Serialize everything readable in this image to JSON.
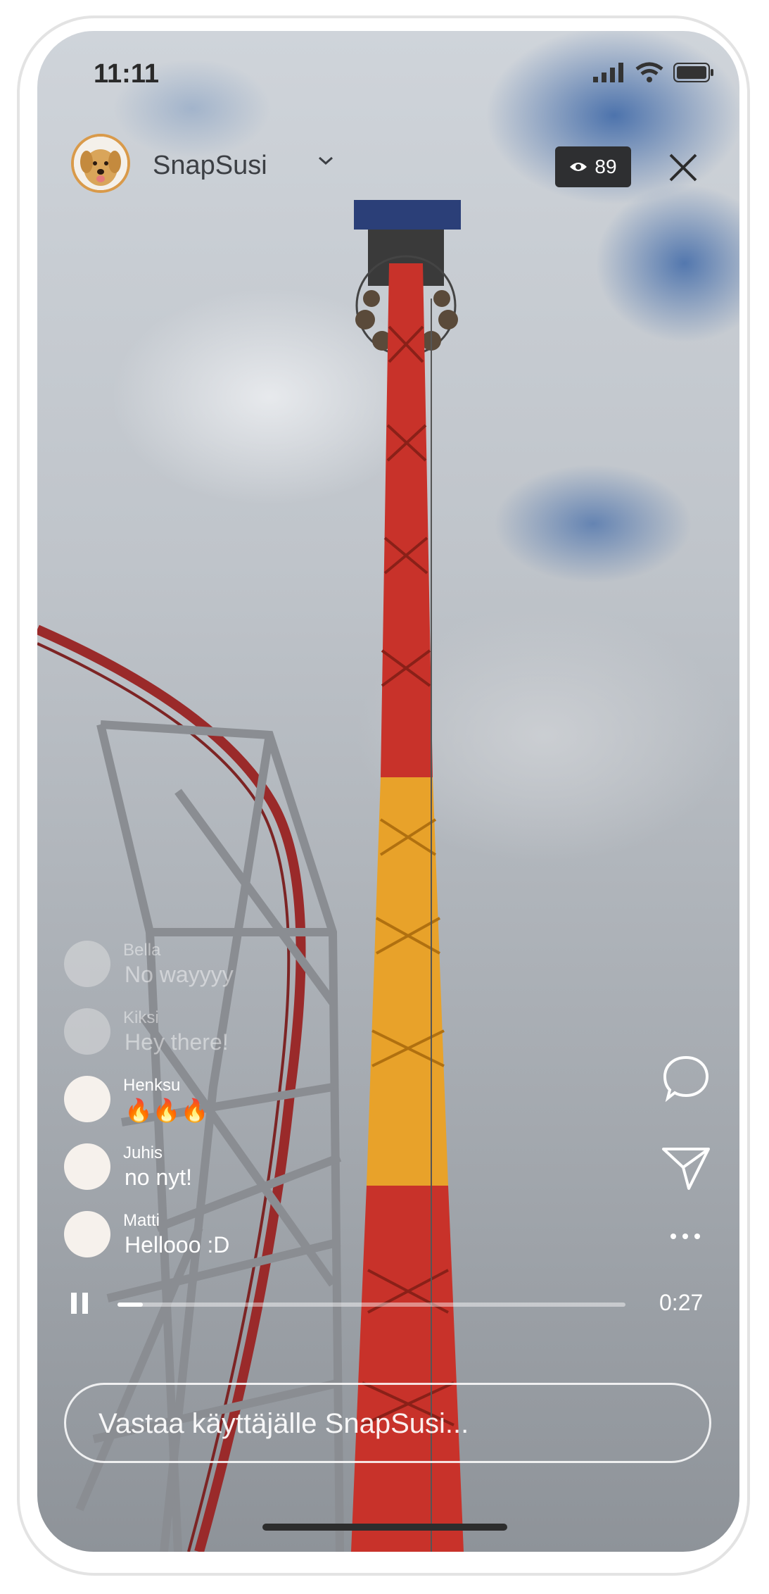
{
  "status_bar": {
    "time": "11:11"
  },
  "header": {
    "username": "SnapSusi",
    "viewer_count": "89"
  },
  "comments": [
    {
      "name": "Bella",
      "text": "No wayyyy",
      "faded": true
    },
    {
      "name": "Kiksi",
      "text": "Hey there!",
      "faded": true
    },
    {
      "name": "Henksu",
      "text": "🔥🔥🔥",
      "faded": false
    },
    {
      "name": "Juhis",
      "text": "no nyt!",
      "faded": false
    },
    {
      "name": "Matti",
      "text": "Hellooo :D",
      "faded": false
    }
  ],
  "playback": {
    "progress": 0.05,
    "duration": "0:27"
  },
  "reply": {
    "placeholder": "Vastaa käyttäjälle SnapSusi..."
  },
  "colors": {
    "tower_red": "#c8322a",
    "tower_orange": "#e8a22a",
    "coaster_gray": "#8a8d92"
  },
  "icons": [
    "signal-icon",
    "wifi-icon",
    "battery-icon",
    "chevron-down-icon",
    "eye-icon",
    "close-icon",
    "comment-icon",
    "share-icon",
    "more-icon",
    "pause-icon"
  ]
}
